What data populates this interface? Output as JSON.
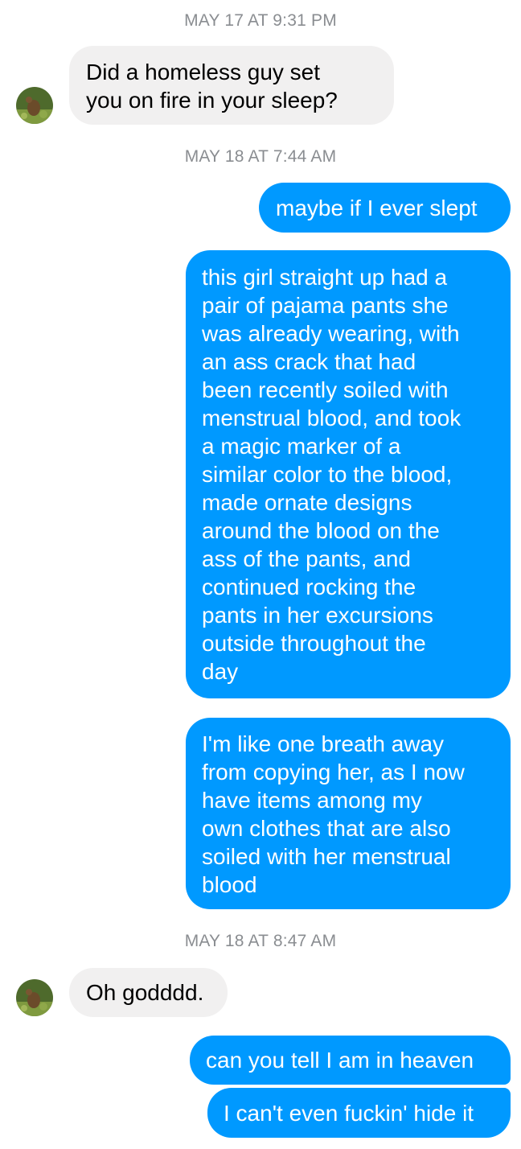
{
  "conversation": {
    "timestamps": [
      "MAY 17 AT 9:31 PM",
      "MAY 18 AT 7:44 AM",
      "MAY 18 AT 8:47 AM"
    ],
    "messages": [
      {
        "sender": "other",
        "text": "Did a homeless guy set\nyou on fire in your sleep?"
      },
      {
        "sender": "me",
        "text": "maybe if I ever slept"
      },
      {
        "sender": "me",
        "text": "this girl straight up had a\npair of pajama pants she\nwas already wearing, with\nan ass crack that had\nbeen recently soiled with\nmenstrual blood, and took\na magic marker of a\nsimilar color to the blood,\nmade ornate designs\naround the blood on the\nass of the pants, and\ncontinued rocking the\npants in her excursions\noutside throughout the\nday"
      },
      {
        "sender": "me",
        "text": "I'm like one breath away\nfrom copying her, as I now\nhave items among my\nown clothes that are also\nsoiled with her menstrual\nblood"
      },
      {
        "sender": "other",
        "text": "Oh godddd."
      },
      {
        "sender": "me",
        "text": "can you tell I am in heaven"
      },
      {
        "sender": "me",
        "text": "I can't even fuckin' hide it"
      }
    ],
    "avatar_icon": "contact-photo-avatar-icon"
  },
  "colors": {
    "outgoing_bubble": "#0099ff",
    "incoming_bubble": "#f1f0f0",
    "timestamp_text": "#8a8d91"
  }
}
